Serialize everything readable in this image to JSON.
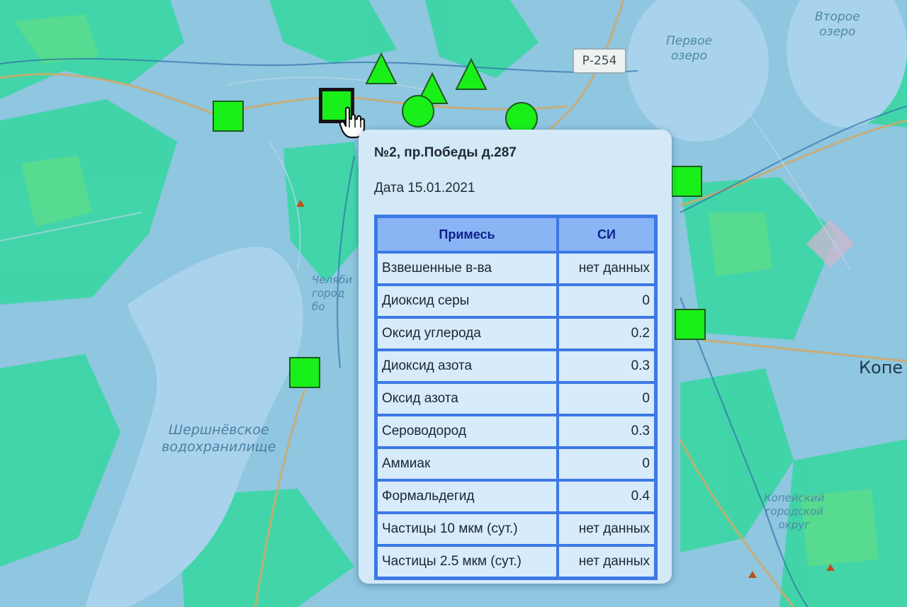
{
  "map": {
    "labels": {
      "lake1": "Второе\nозеро",
      "lake2": "Первое\nозеро",
      "reservoir": "Шершнёвское\nводохранилище",
      "forest": "Челяби\nгород\nбо",
      "district": "Копейский\nгородской\nокруг",
      "city": "Копе"
    },
    "road_shield": "Р-254",
    "colors": {
      "water": "#8fc6e0",
      "forest": "#34d8a2",
      "marker": "#19f019"
    },
    "markers": [
      {
        "shape": "square",
        "name": "station-marker-1"
      },
      {
        "shape": "square",
        "name": "station-marker-2-selected"
      },
      {
        "shape": "triangle",
        "name": "station-marker-3"
      },
      {
        "shape": "triangle",
        "name": "station-marker-4"
      },
      {
        "shape": "triangle",
        "name": "station-marker-5"
      },
      {
        "shape": "circle",
        "name": "station-marker-6"
      },
      {
        "shape": "circle",
        "name": "station-marker-7"
      },
      {
        "shape": "square",
        "name": "station-marker-8"
      },
      {
        "shape": "square",
        "name": "station-marker-9"
      },
      {
        "shape": "square",
        "name": "station-marker-10"
      }
    ]
  },
  "popup": {
    "title": "№2, пр.Победы д.287",
    "date": "Дата 15.01.2021",
    "table": {
      "headers": [
        "Примесь",
        "СИ"
      ],
      "rows": [
        [
          "Взвешенные в-ва",
          "нет данных"
        ],
        [
          "Диоксид серы",
          "0"
        ],
        [
          "Оксид углерода",
          "0.2"
        ],
        [
          "Диоксид азота",
          "0.3"
        ],
        [
          "Оксид азота",
          "0"
        ],
        [
          "Сероводород",
          "0.3"
        ],
        [
          "Аммиак",
          "0"
        ],
        [
          "Формальдегид",
          "0.4"
        ],
        [
          "Частицы 10 мкм (сут.)",
          "нет данных"
        ],
        [
          "Частицы 2.5 мкм (сут.)",
          "нет данных"
        ]
      ]
    }
  }
}
